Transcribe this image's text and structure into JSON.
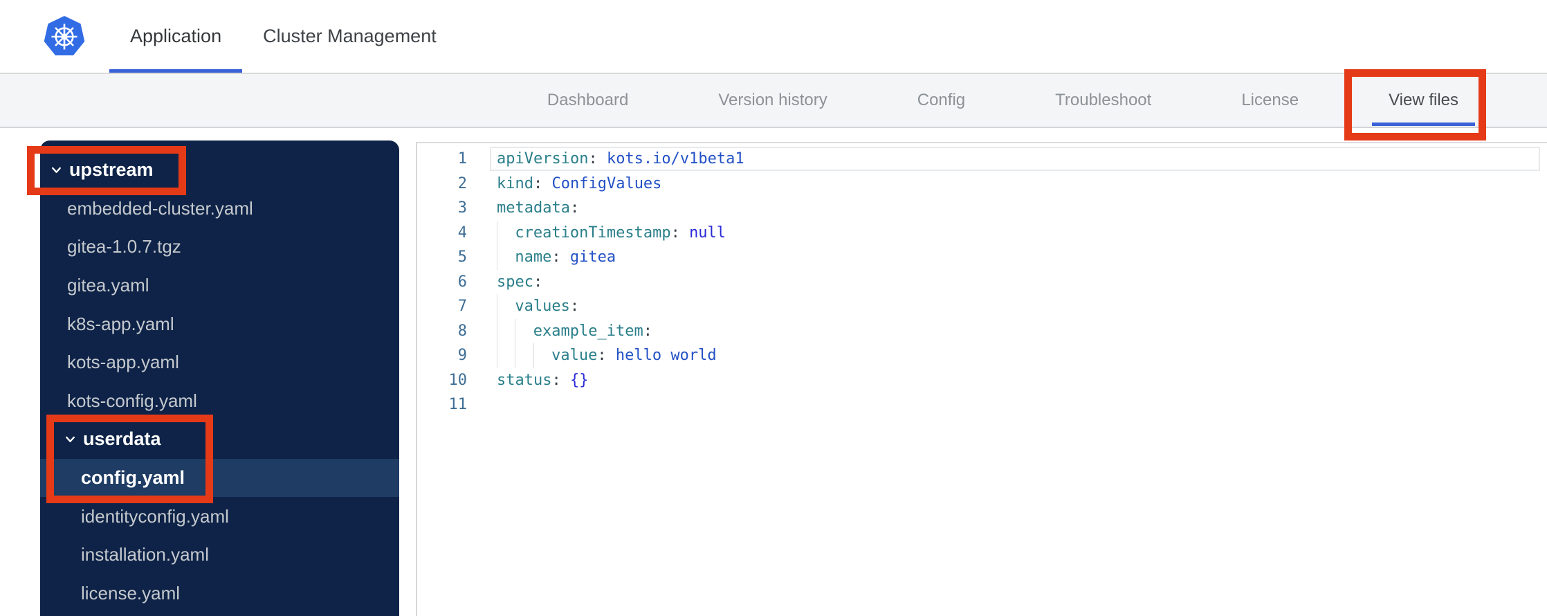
{
  "app": {
    "logo": "kubernetes-logo",
    "brand_color": "#326CE5"
  },
  "header": {
    "tabs": [
      {
        "label": "Application",
        "active": true
      },
      {
        "label": "Cluster Management",
        "active": false
      }
    ]
  },
  "nav": {
    "tabs": [
      {
        "label": "Dashboard",
        "active": false
      },
      {
        "label": "Version history",
        "active": false
      },
      {
        "label": "Config",
        "active": false
      },
      {
        "label": "Troubleshoot",
        "active": false
      },
      {
        "label": "License",
        "active": false
      },
      {
        "label": "View files",
        "active": true,
        "annotated": true
      }
    ]
  },
  "sidebar": {
    "items": [
      {
        "label": "upstream",
        "type": "folder",
        "depth": 0,
        "expanded": true,
        "annotated": true
      },
      {
        "label": "embedded-cluster.yaml",
        "type": "file",
        "depth": 1
      },
      {
        "label": "gitea-1.0.7.tgz",
        "type": "file",
        "depth": 1
      },
      {
        "label": "gitea.yaml",
        "type": "file",
        "depth": 1
      },
      {
        "label": "k8s-app.yaml",
        "type": "file",
        "depth": 1
      },
      {
        "label": "kots-app.yaml",
        "type": "file",
        "depth": 1
      },
      {
        "label": "kots-config.yaml",
        "type": "file",
        "depth": 1
      },
      {
        "label": "userdata",
        "type": "folder",
        "depth": 1,
        "expanded": true,
        "annotated": true
      },
      {
        "label": "config.yaml",
        "type": "file",
        "depth": 2,
        "selected": true,
        "annotated": true
      },
      {
        "label": "identityconfig.yaml",
        "type": "file",
        "depth": 2
      },
      {
        "label": "installation.yaml",
        "type": "file",
        "depth": 2
      },
      {
        "label": "license.yaml",
        "type": "file",
        "depth": 2
      }
    ]
  },
  "editor": {
    "language": "yaml",
    "lines": [
      {
        "num": 1,
        "ind": 0,
        "active": true,
        "tok": [
          [
            "k",
            "apiVersion"
          ],
          [
            "p",
            ": "
          ],
          [
            "v",
            "kots.io/v1beta1"
          ]
        ]
      },
      {
        "num": 2,
        "ind": 0,
        "tok": [
          [
            "k",
            "kind"
          ],
          [
            "p",
            ": "
          ],
          [
            "v",
            "ConfigValues"
          ]
        ]
      },
      {
        "num": 3,
        "ind": 0,
        "tok": [
          [
            "k",
            "metadata"
          ],
          [
            "p",
            ":"
          ]
        ]
      },
      {
        "num": 4,
        "ind": 1,
        "tok": [
          [
            "k",
            "creationTimestamp"
          ],
          [
            "p",
            ": "
          ],
          [
            "c",
            "null"
          ]
        ]
      },
      {
        "num": 5,
        "ind": 1,
        "tok": [
          [
            "k",
            "name"
          ],
          [
            "p",
            ": "
          ],
          [
            "v",
            "gitea"
          ]
        ]
      },
      {
        "num": 6,
        "ind": 0,
        "tok": [
          [
            "k",
            "spec"
          ],
          [
            "p",
            ":"
          ]
        ]
      },
      {
        "num": 7,
        "ind": 1,
        "tok": [
          [
            "k",
            "values"
          ],
          [
            "p",
            ":"
          ]
        ]
      },
      {
        "num": 8,
        "ind": 2,
        "tok": [
          [
            "k",
            "example_item"
          ],
          [
            "p",
            ":"
          ]
        ]
      },
      {
        "num": 9,
        "ind": 3,
        "tok": [
          [
            "k",
            "value"
          ],
          [
            "p",
            ": "
          ],
          [
            "v",
            "hello world"
          ]
        ]
      },
      {
        "num": 10,
        "ind": 0,
        "tok": [
          [
            "k",
            "status"
          ],
          [
            "p",
            ": "
          ],
          [
            "c",
            "{}"
          ]
        ]
      },
      {
        "num": 11,
        "ind": 0,
        "tok": []
      }
    ]
  },
  "annotations": {
    "color": "#e53a17",
    "targets": [
      "view-files-tab",
      "upstream-folder",
      "userdata-folder-and-config-yaml"
    ]
  },
  "colors": {
    "sidebar_bg": "#0e2347",
    "sidebar_selected_bg": "#1e3c64",
    "active_tab_underline": "#3a62d8",
    "subnav_bg": "#f4f5f7",
    "yaml_key": "#2a7f8a",
    "yaml_value": "#2351c5",
    "yaml_constant": "#2b2bd8",
    "line_number": "#3e6e96"
  }
}
